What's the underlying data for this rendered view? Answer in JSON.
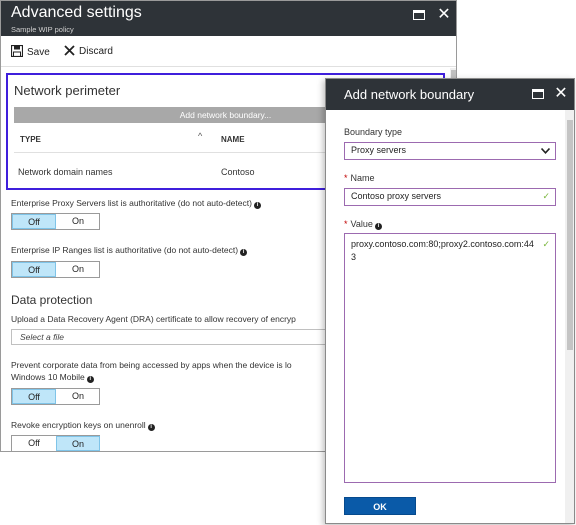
{
  "advanced_settings": {
    "title": "Advanced settings",
    "subtitle": "Sample WIP policy",
    "commands": {
      "save": "Save",
      "discard": "Discard"
    },
    "network_perimeter": {
      "heading": "Network perimeter",
      "add_button": "Add network boundary...",
      "columns": [
        "TYPE",
        "NAME"
      ],
      "rows": [
        {
          "type": "Network domain names",
          "name": "Contoso"
        }
      ]
    },
    "proxy_authoritative": {
      "label": "Enterprise Proxy Servers list is authoritative (do not auto-detect)",
      "off": "Off",
      "on": "On",
      "selected": "Off"
    },
    "ip_authoritative": {
      "label": "Enterprise IP Ranges list is authoritative (do not auto-detect)",
      "off": "Off",
      "on": "On",
      "selected": "Off"
    },
    "data_protection": {
      "heading": "Data protection",
      "dra_label": "Upload a Data Recovery Agent (DRA) certificate to allow recovery of encryp",
      "dra_placeholder": "Select a file",
      "prevent_label_1": "Prevent corporate data from being accessed by apps when the device is lo",
      "prevent_label_2": "Windows 10 Mobile",
      "prevent": {
        "off": "Off",
        "on": "On",
        "selected": "Off"
      },
      "revoke_label": "Revoke encryption keys on unenroll",
      "revoke": {
        "off": "Off",
        "on": "On",
        "selected": "On"
      }
    }
  },
  "add_boundary": {
    "title": "Add network boundary",
    "boundary_type_label": "Boundary type",
    "boundary_type_value": "Proxy servers",
    "name_label": "Name",
    "name_value": "Contoso proxy servers",
    "value_label": "Value",
    "value_text": "proxy.contoso.com:80;proxy2.contoso.com:443",
    "ok": "OK"
  },
  "colors": {
    "titlebar": "#2e3338",
    "highlight": "#3f1fdc",
    "primary_button": "#0a5aa8",
    "toggle_selected": "#bfe6f9"
  }
}
